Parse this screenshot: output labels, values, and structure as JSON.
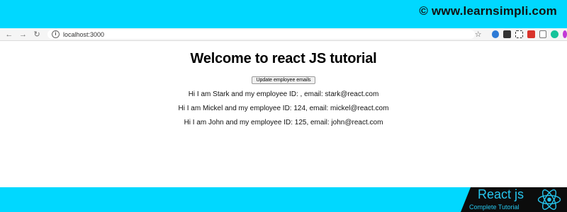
{
  "watermark": "©  www.learnsimpli.com",
  "browser": {
    "url": "localhost:3000"
  },
  "page": {
    "heading": "Welcome to react JS tutorial",
    "update_button": "Update employee emails",
    "employees": [
      "Hi I am Stark and my employee ID: , email: stark@react.com",
      "Hi I am Mickel and my employee ID: 124, email: mickel@react.com",
      "Hi I am John and my employee ID: 125, email: john@react.com"
    ]
  },
  "badge": {
    "title": "React js",
    "subtitle": "Complete Tutorial"
  },
  "colors": {
    "banner": "#00d8ff",
    "badge_bg": "#0c0c0c",
    "badge_text": "#26c6ee"
  }
}
